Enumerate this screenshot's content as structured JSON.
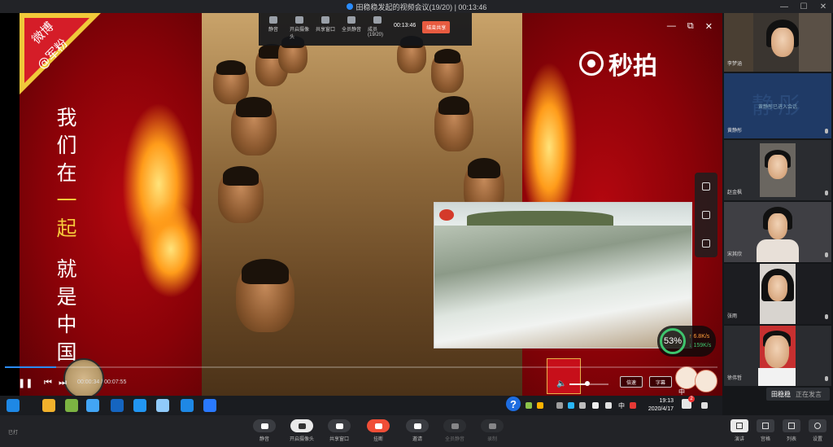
{
  "window": {
    "title": "田稳稳发起的视频会议(19/20) | 00:13:46",
    "controls": [
      "—",
      "☐",
      "✕"
    ]
  },
  "meeting_toolbar": {
    "items": [
      {
        "label": "静音",
        "icon": "mic-icon"
      },
      {
        "label": "开启摄像头",
        "icon": "camera-icon"
      },
      {
        "label": "共享窗口",
        "icon": "share-window-icon"
      },
      {
        "label": "全员静音",
        "icon": "mute-all-icon"
      },
      {
        "label": "成员(19/20)",
        "icon": "members-icon"
      }
    ],
    "timer": "00:13:46",
    "end_label": "结束共享",
    "status": "00:13:46"
  },
  "shared_video": {
    "badge_line1": "微博",
    "badge_line2": "@军粉",
    "vertical_text": [
      "我",
      "们",
      "在",
      "一",
      "起",
      "就",
      "是",
      "中",
      "国"
    ],
    "highlight_chars": [
      "一",
      "起"
    ],
    "watermark": "秒拍",
    "share_controls": [
      "—",
      "⧉",
      "✕"
    ]
  },
  "player": {
    "current_time": "00:00:34",
    "total_time": "00:07:55",
    "time_display": "00:00:34 / 00:07:55",
    "progress": 0.072,
    "volume": 0.45,
    "speed_label": "倍速",
    "subtitle_label": "字幕"
  },
  "network": {
    "percent": "53%",
    "up": "6.8",
    "up_unit": "K/s",
    "down": "159",
    "down_unit": "K/s"
  },
  "cartoon_label": "中",
  "taskbar": {
    "clock_time": "19:13",
    "clock_date": "2020/4/17",
    "ime": "中",
    "help": "?"
  },
  "participants": [
    {
      "name": "李梦涵",
      "type": "video"
    },
    {
      "name": "黄静彤",
      "type": "avatar",
      "display": "静彤",
      "sub": "黄静彤已进入会话"
    },
    {
      "name": "赵金枫",
      "type": "video"
    },
    {
      "name": "宋其欣",
      "type": "video"
    },
    {
      "name": "张雨",
      "type": "video"
    },
    {
      "name": "徐伟哲",
      "type": "video"
    }
  ],
  "speaking": {
    "name": "田稳稳",
    "status": "正在发言"
  },
  "bottom_bar": {
    "footer_left": "已打",
    "buttons": [
      {
        "label": "静音",
        "icon": "mic-icon",
        "state": "normal"
      },
      {
        "label": "开启摄像头",
        "icon": "camera-icon",
        "state": "white"
      },
      {
        "label": "共享窗口",
        "icon": "share-window-icon",
        "state": "normal"
      },
      {
        "label": "挂断",
        "icon": "hangup-icon",
        "state": "red"
      },
      {
        "label": "邀请",
        "icon": "invite-icon",
        "state": "normal"
      },
      {
        "label": "全员静音",
        "icon": "mute-all-icon",
        "state": "dim"
      },
      {
        "label": "录制",
        "icon": "record-icon",
        "state": "dim"
      }
    ],
    "view_buttons": [
      {
        "label": "演讲",
        "icon": "speaker-view-icon",
        "active": true
      },
      {
        "label": "宫格",
        "icon": "grid-view-icon",
        "active": false
      },
      {
        "label": "列表",
        "icon": "list-view-icon",
        "active": false
      },
      {
        "label": "设置",
        "icon": "settings-gear-icon",
        "active": false
      }
    ]
  },
  "colors": {
    "accent": "#2a8cff",
    "hangup": "#f04e37",
    "background_red": "#8a0208",
    "signal_green": "#3ec46d"
  }
}
